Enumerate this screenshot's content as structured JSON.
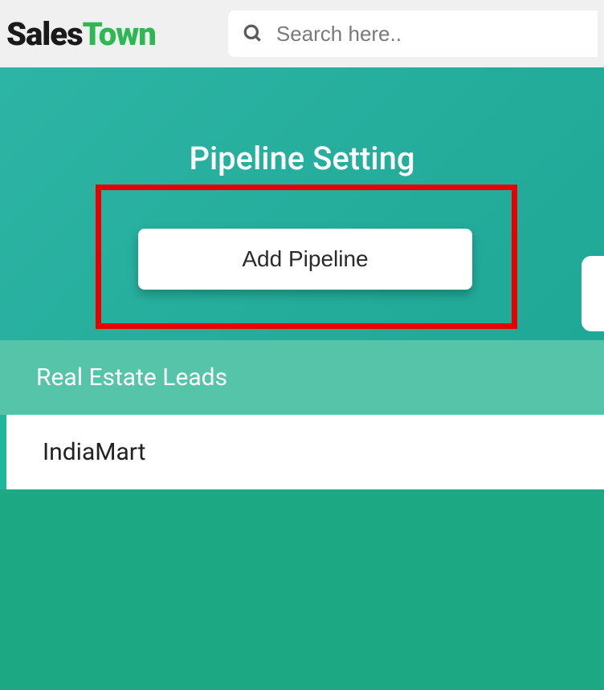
{
  "logo": {
    "part1": "Sales",
    "part2": "Town"
  },
  "search": {
    "placeholder": "Search here.."
  },
  "page_title": "Pipeline Setting",
  "add_button_label": "Add Pipeline",
  "pipelines": [
    {
      "label": "Real Estate Leads",
      "active": false
    },
    {
      "label": "IndiaMart",
      "active": true
    }
  ]
}
